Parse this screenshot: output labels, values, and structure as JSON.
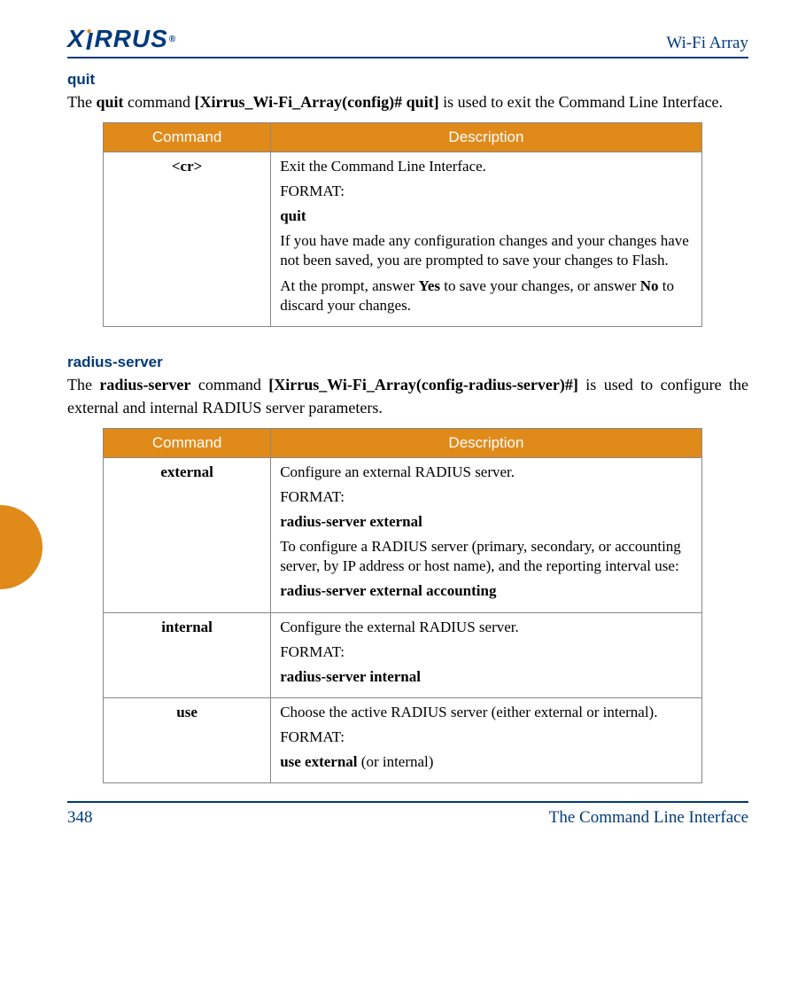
{
  "header": {
    "brand": "XIRRUS",
    "product": "Wi-Fi Array"
  },
  "sections": [
    {
      "title": "quit",
      "intro_pre": "The ",
      "intro_cmd": "quit",
      "intro_mid": " command ",
      "intro_prompt": "[Xirrus_Wi-Fi_Array(config)# quit]",
      "intro_post": " is used to exit the Command Line Interface.",
      "rows": [
        {
          "command": "<cr>",
          "desc": {
            "line1": "Exit the Command Line Interface.",
            "format_label": "FORMAT:",
            "format_value": "quit",
            "para1": "If you have made any configuration changes and your changes have not been saved, you are prompted to save your changes to Flash.",
            "para2_pre": "At the prompt, answer ",
            "para2_yes": "Yes",
            "para2_mid": " to save your changes, or answer ",
            "para2_no": "No",
            "para2_post": " to discard your changes."
          }
        }
      ]
    },
    {
      "title": "radius-server",
      "intro_pre": "The ",
      "intro_cmd": "radius-server",
      "intro_mid": " command ",
      "intro_prompt": "[Xirrus_Wi-Fi_Array(config-radius-server)#]",
      "intro_post": " is used to configure the external and internal RADIUS server parameters.",
      "rows": [
        {
          "command": "external",
          "desc": {
            "line1": "Configure an external RADIUS server.",
            "format_label": "FORMAT:",
            "format_value": "radius-server external",
            "para1": "To configure a RADIUS server (primary, secondary, or accounting server, by IP address or host name), and the reporting interval use:",
            "format_value2": "radius-server external accounting"
          }
        },
        {
          "command": "internal",
          "desc": {
            "line1": "Configure the external RADIUS server.",
            "format_label": "FORMAT:",
            "format_value": "radius-server internal"
          }
        },
        {
          "command": "use",
          "desc": {
            "line1": "Choose the active RADIUS server (either external or internal).",
            "format_label": "FORMAT:",
            "format_value_pre": "use external",
            "format_value_post": " (or internal)"
          }
        }
      ]
    }
  ],
  "table_headers": {
    "col1": "Command",
    "col2": "Description"
  },
  "footer": {
    "page": "348",
    "section": "The Command Line Interface"
  }
}
